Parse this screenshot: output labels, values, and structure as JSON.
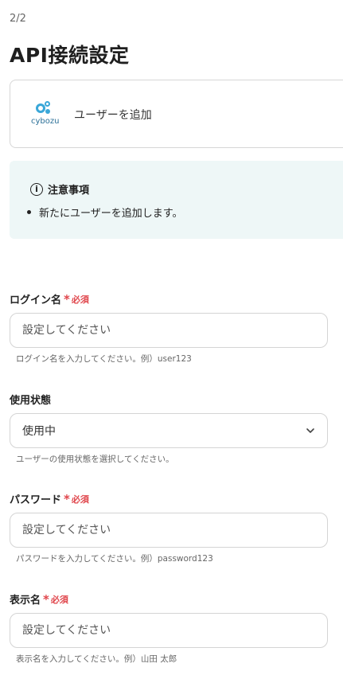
{
  "header": {
    "step": "2/2",
    "title": "API接続設定"
  },
  "app": {
    "logo_text": "cybozu",
    "action": "ユーザーを追加"
  },
  "notice": {
    "title": "注意事項",
    "items": [
      "新たにユーザーを追加します。"
    ]
  },
  "required": {
    "star": "*",
    "text": "必須"
  },
  "fields": {
    "login": {
      "label": "ログイン名",
      "placeholder": "設定してください",
      "help": "ログイン名を入力してください。例）user123"
    },
    "status": {
      "label": "使用状態",
      "value": "使用中",
      "help": "ユーザーの使用状態を選択してください。"
    },
    "password": {
      "label": "パスワード",
      "placeholder": "設定してください",
      "help": "パスワードを入力してください。例）password123"
    },
    "display_name": {
      "label": "表示名",
      "placeholder": "設定してください",
      "help": "表示名を入力してください。例）山田 太郎"
    }
  },
  "colors": {
    "required": "#e0454b",
    "notice_bg": "#eef7f7",
    "brand": "#3aa7d8"
  }
}
